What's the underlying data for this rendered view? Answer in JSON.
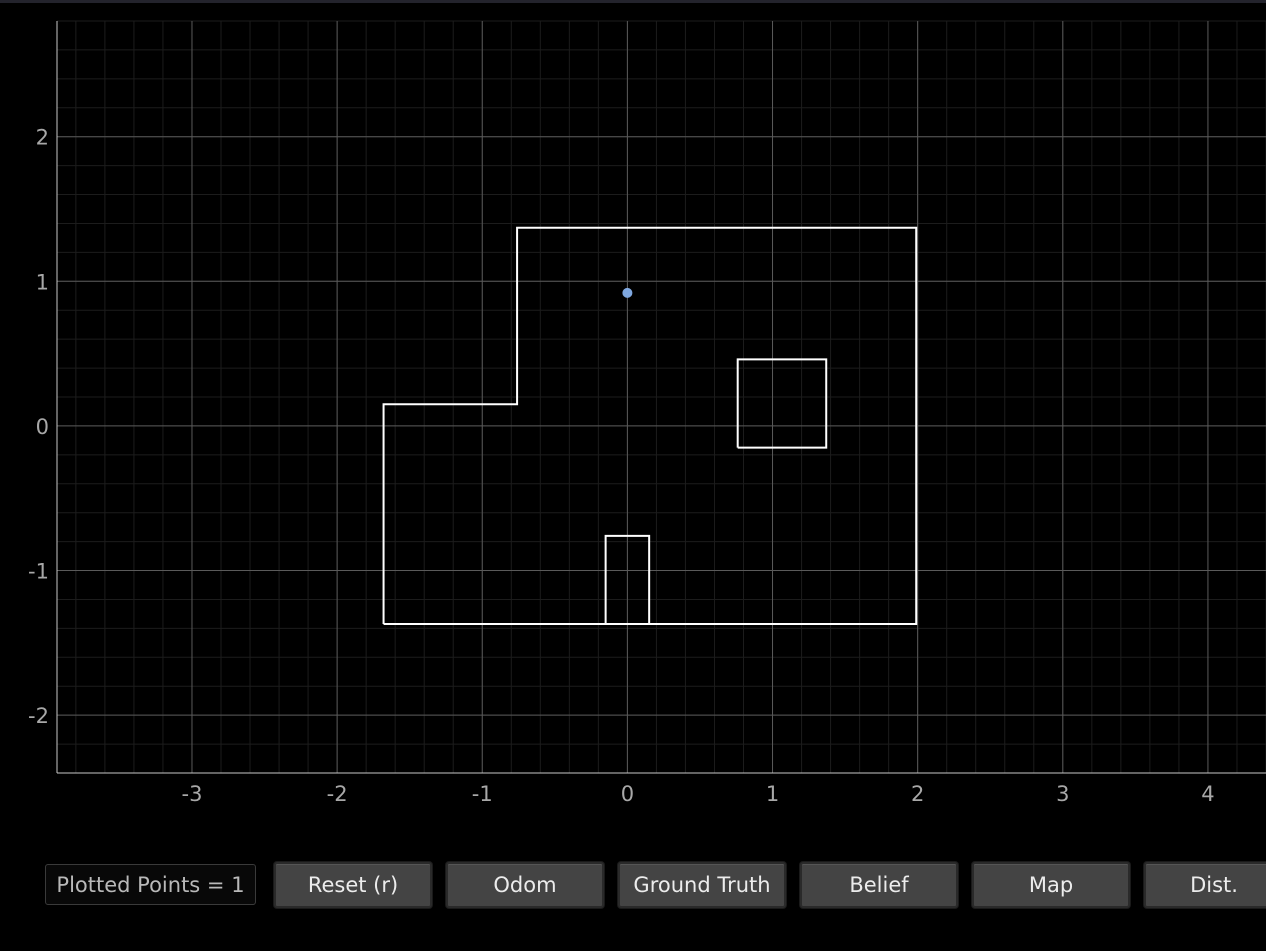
{
  "plot": {
    "x_ticks": [
      "-3",
      "-2",
      "-1",
      "0",
      "1",
      "2",
      "3",
      "4"
    ],
    "y_ticks": [
      "2",
      "1",
      "0",
      "-1",
      "-2"
    ],
    "x_range": [
      -3.93,
      4.4
    ],
    "y_range": [
      -2.4,
      2.8
    ],
    "grid_major_step": 1,
    "grid_minor_step": 0.2,
    "colors": {
      "background": "#000000",
      "major_grid": "#5a5a5a",
      "minor_grid": "#1c1c1c",
      "axis": "#c8c8c8",
      "map_lines": "#ffffff",
      "point": "#7fa8e0"
    },
    "map_polylines": [
      [
        [
          -1.68,
          -1.37
        ],
        [
          1.99,
          -1.37
        ],
        [
          1.99,
          1.37
        ],
        [
          -0.76,
          1.37
        ],
        [
          -0.76,
          0.15
        ],
        [
          -1.68,
          0.15
        ],
        [
          -1.68,
          -1.37
        ]
      ],
      [
        [
          -0.15,
          -1.37
        ],
        [
          -0.15,
          -0.76
        ],
        [
          0.15,
          -0.76
        ],
        [
          0.15,
          -1.37
        ]
      ],
      [
        [
          0.76,
          -0.15
        ],
        [
          1.37,
          -0.15
        ],
        [
          1.37,
          0.46
        ],
        [
          0.76,
          0.46
        ],
        [
          0.76,
          -0.15
        ]
      ]
    ],
    "points": [
      {
        "x": 0.0,
        "y": 0.92
      }
    ]
  },
  "status": {
    "plotted_points": "Plotted Points = 1"
  },
  "buttons": {
    "reset": "Reset (r)",
    "odom": "Odom",
    "ground_truth": "Ground Truth",
    "belief": "Belief",
    "map": "Map",
    "dist": "Dist."
  }
}
